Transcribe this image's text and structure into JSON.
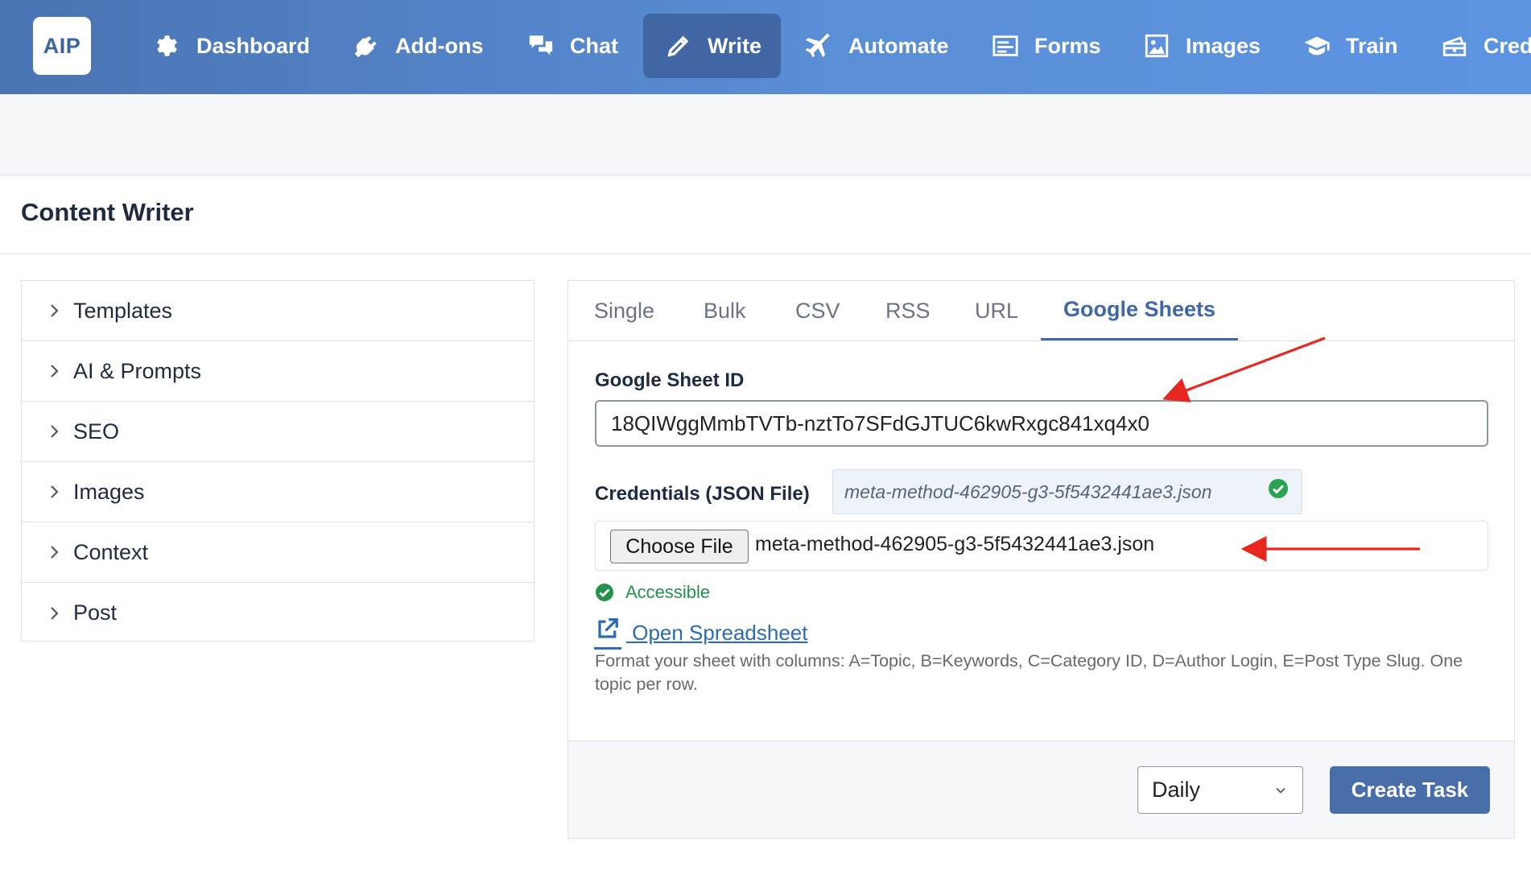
{
  "nav": {
    "logo": "AIP",
    "items": [
      {
        "label": "Dashboard",
        "icon": "gear-icon"
      },
      {
        "label": "Add-ons",
        "icon": "plugin-icon"
      },
      {
        "label": "Chat",
        "icon": "chat-bubbles-icon"
      },
      {
        "label": "Write",
        "icon": "pencil-icon"
      },
      {
        "label": "Automate",
        "icon": "plane-icon"
      },
      {
        "label": "Forms",
        "icon": "form-icon"
      },
      {
        "label": "Images",
        "icon": "image-icon"
      },
      {
        "label": "Train",
        "icon": "graduation-cap-icon"
      },
      {
        "label": "Cred",
        "icon": "money-icon"
      }
    ],
    "active": "Write"
  },
  "page": {
    "title": "Content Writer"
  },
  "sidebar": {
    "items": [
      {
        "label": "Templates"
      },
      {
        "label": "AI & Prompts"
      },
      {
        "label": "SEO"
      },
      {
        "label": "Images"
      },
      {
        "label": "Context"
      },
      {
        "label": "Post"
      }
    ]
  },
  "tabs": {
    "items": [
      {
        "label": "Single"
      },
      {
        "label": "Bulk"
      },
      {
        "label": "CSV"
      },
      {
        "label": "RSS"
      },
      {
        "label": "URL"
      },
      {
        "label": "Google Sheets"
      }
    ],
    "active": "Google Sheets"
  },
  "form": {
    "sheet_id_label": "Google Sheet ID",
    "sheet_id_value": "18QIWggMmbTVTb-nztTo7SFdGJTUC6kwRxgc841xq4x0",
    "credentials_label": "Credentials (JSON File)",
    "credentials_file_badge": "meta-method-462905-g3-5f5432441ae3.json",
    "choose_file_label": "Choose File",
    "chosen_file_name": "meta-method-462905-g3-5f5432441ae3.json",
    "status_text": "Accessible",
    "open_link_text": " Open Spreadsheet",
    "help_text": "Format your sheet with columns: A=Topic, B=Keywords, C=Category ID, D=Author Login, E=Post Type Slug. One topic per row."
  },
  "footer": {
    "frequency_value": "Daily",
    "create_label": "Create Task"
  },
  "colors": {
    "accent": "#3f68a6",
    "success": "#23924a",
    "annotation_arrow": "#e8281e"
  }
}
